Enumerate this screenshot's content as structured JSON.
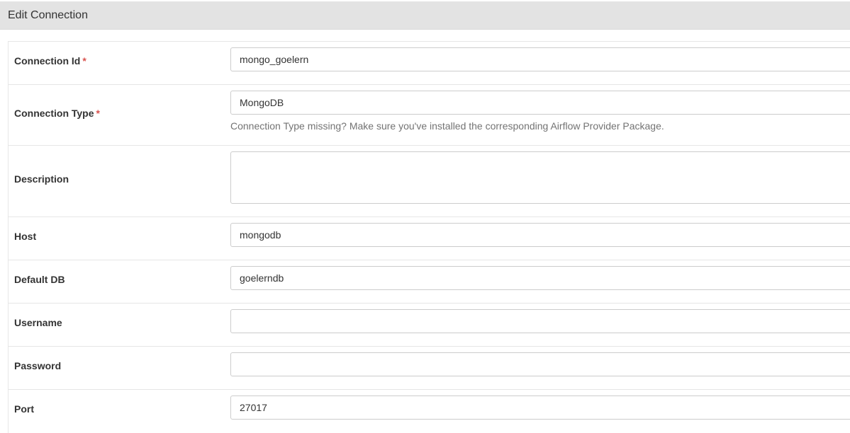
{
  "panel": {
    "title": "Edit Connection"
  },
  "fields": {
    "conn_id": {
      "label": "Connection Id",
      "required": "*",
      "value": "mongo_goelern"
    },
    "conn_type": {
      "label": "Connection Type",
      "required": "*",
      "value": "MongoDB",
      "help": "Connection Type missing? Make sure you've installed the corresponding Airflow Provider Package."
    },
    "description": {
      "label": "Description",
      "value": ""
    },
    "host": {
      "label": "Host",
      "value": "mongodb"
    },
    "schema": {
      "label": "Default DB",
      "value": "goelerndb"
    },
    "login": {
      "label": "Username",
      "value": ""
    },
    "password": {
      "label": "Password",
      "value": ""
    },
    "port": {
      "label": "Port",
      "value": "27017"
    }
  },
  "colors": {
    "required_marker": "#d9534f",
    "heading_bg": "#e3e3e3",
    "border": "#cccccc"
  }
}
